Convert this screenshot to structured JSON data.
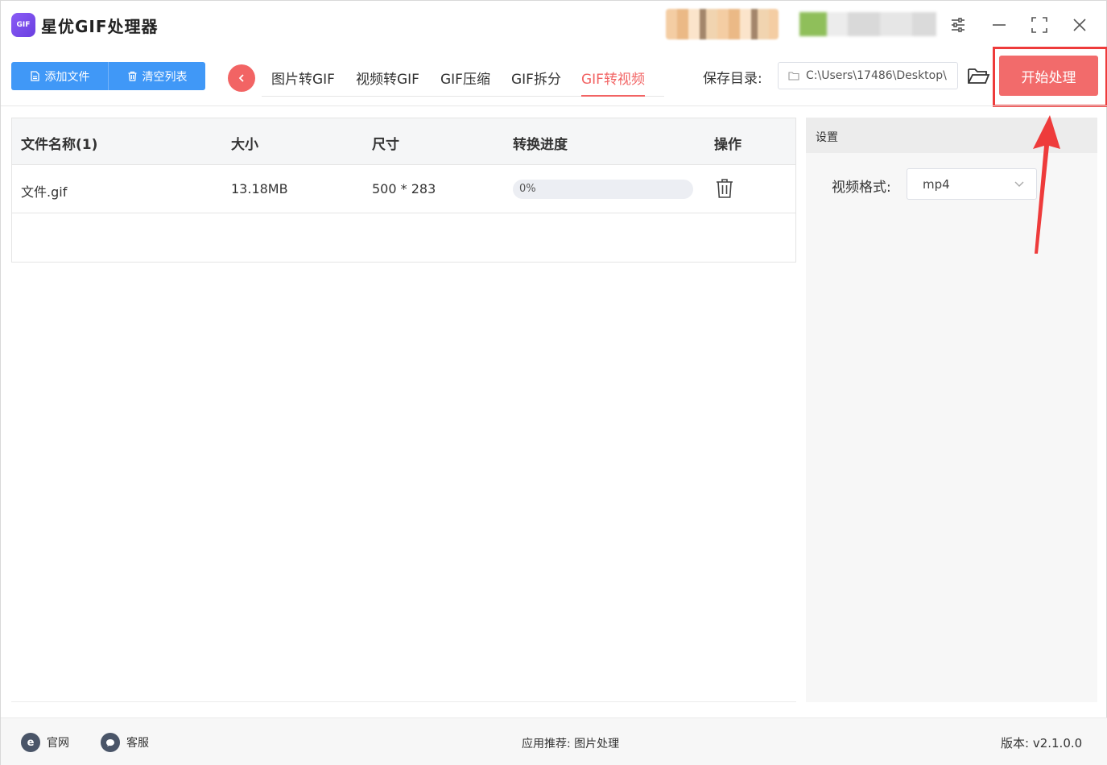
{
  "app": {
    "title": "星优GIF处理器",
    "logo_text": "GIF"
  },
  "toolbar": {
    "add_file": "添加文件",
    "clear_list": "清空列表"
  },
  "tabs": [
    {
      "label": "图片转GIF",
      "active": false
    },
    {
      "label": "视频转GIF",
      "active": false
    },
    {
      "label": "GIF压缩",
      "active": false
    },
    {
      "label": "GIF拆分",
      "active": false
    },
    {
      "label": "GIF转视频",
      "active": true
    }
  ],
  "save": {
    "label": "保存目录:",
    "path": "C:\\Users\\17486\\Desktop\\"
  },
  "start_button": "开始处理",
  "table": {
    "headers": [
      "文件名称(1)",
      "大小",
      "尺寸",
      "转换进度",
      "操作"
    ],
    "rows": [
      {
        "name": "文件.gif",
        "size": "13.18MB",
        "dims": "500 * 283",
        "progress": "0%",
        "progress_value": 0
      }
    ]
  },
  "settings": {
    "title": "设置",
    "video_format_label": "视频格式:",
    "video_format_value": "mp4"
  },
  "footer": {
    "website": "官网",
    "service": "客服",
    "recommend": "应用推荐:  图片处理",
    "version": "版本:  v2.1.0.0"
  },
  "colors": {
    "accent": "#f26464",
    "primary": "#4098f7",
    "highlight": "#ee3b3b"
  },
  "icons": [
    "app-logo",
    "file-icon",
    "trash-icon",
    "back-icon",
    "folder-icon",
    "chevron-down-icon",
    "settings-sliders-icon",
    "minimize-icon",
    "maximize-icon",
    "close-icon",
    "ie-icon",
    "chat-icon"
  ]
}
